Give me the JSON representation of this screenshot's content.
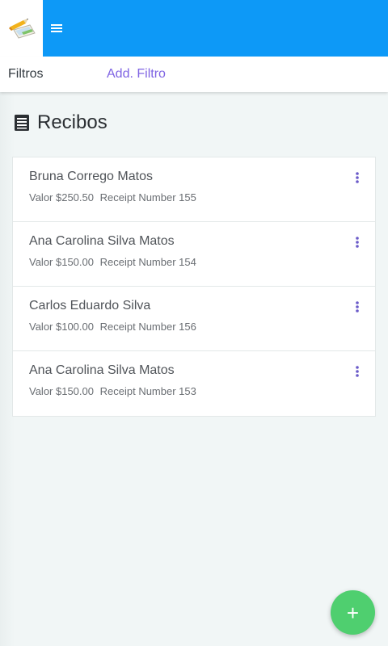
{
  "header": {
    "logo_icon": "pencil-paper-logo-icon",
    "menu_icon": "hamburger-menu-icon",
    "bar_color": "#0d99f7"
  },
  "filters": {
    "label": "Filtros",
    "add_label": "Add. Filtro",
    "add_color": "#7f64e3"
  },
  "page": {
    "title_icon": "receipt-list-icon",
    "title": "Recibos"
  },
  "receipts": [
    {
      "name": "Bruna Corrego Matos",
      "valor": "Valor $250.50",
      "receipt": "Receipt Number 155"
    },
    {
      "name": "Ana Carolina Silva Matos",
      "valor": "Valor $150.00",
      "receipt": "Receipt Number 154"
    },
    {
      "name": "Carlos Eduardo Silva",
      "valor": "Valor $100.00",
      "receipt": "Receipt Number 156"
    },
    {
      "name": "Ana Carolina Silva Matos",
      "valor": "Valor $150.00",
      "receipt": "Receipt Number 153"
    }
  ],
  "fab": {
    "label": "+",
    "icon": "plus-icon",
    "color": "#4fcf6f"
  }
}
